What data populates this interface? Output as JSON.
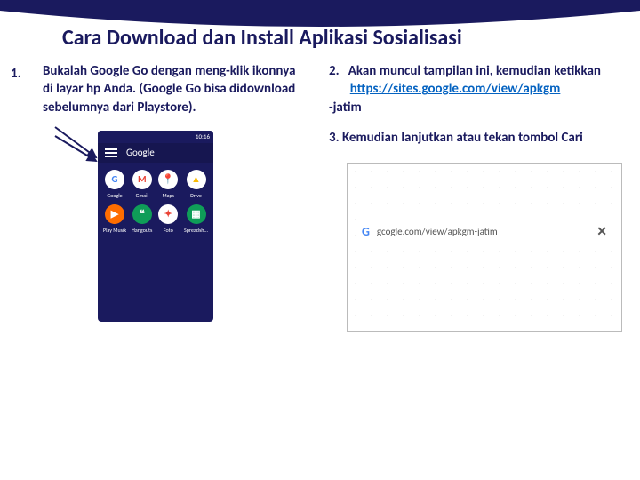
{
  "title": "Cara Download dan Install Aplikasi Sosialisasi",
  "step1_num": "1.",
  "step1": "Bukalah Google Go dengan meng-klik ikonnya\ndi layar hp Anda. (Google Go bisa didownload\nsebelumnya dari Playstore).",
  "step2_num": "2.",
  "step2_a": "Akan muncul tampilan ini, kemudian ketikkan",
  "step2_link": "https://sites.google.com/view/apkgm",
  "step2_b": "-jatim",
  "step3": "3.  Kemudian lanjutkan atau tekan tombol Cari",
  "phone": {
    "time": "10:16",
    "brand_g": "G",
    "brand_rest": "oogle",
    "apps": [
      {
        "label": "Google",
        "bg": "#fff",
        "txt": "G",
        "tc": "#4285f4"
      },
      {
        "label": "Gmail",
        "bg": "#fff",
        "txt": "M",
        "tc": "#ea4335"
      },
      {
        "label": "Maps",
        "bg": "#fff",
        "txt": "📍",
        "tc": "#34a853"
      },
      {
        "label": "Drive",
        "bg": "#fff",
        "txt": "▲",
        "tc": "#fbbc05"
      },
      {
        "label": "Play Musik",
        "bg": "#ff6d00",
        "txt": "▶",
        "tc": "#fff"
      },
      {
        "label": "Hangouts",
        "bg": "#0f9d58",
        "txt": "❝",
        "tc": "#fff"
      },
      {
        "label": "Foto",
        "bg": "#fff",
        "txt": "✦",
        "tc": "#ea4335"
      },
      {
        "label": "Spreadsh...",
        "bg": "#0f9d58",
        "txt": "▦",
        "tc": "#fff"
      }
    ]
  },
  "browser": {
    "search_text": "gcogle.com/view/apkgm-jatim"
  }
}
